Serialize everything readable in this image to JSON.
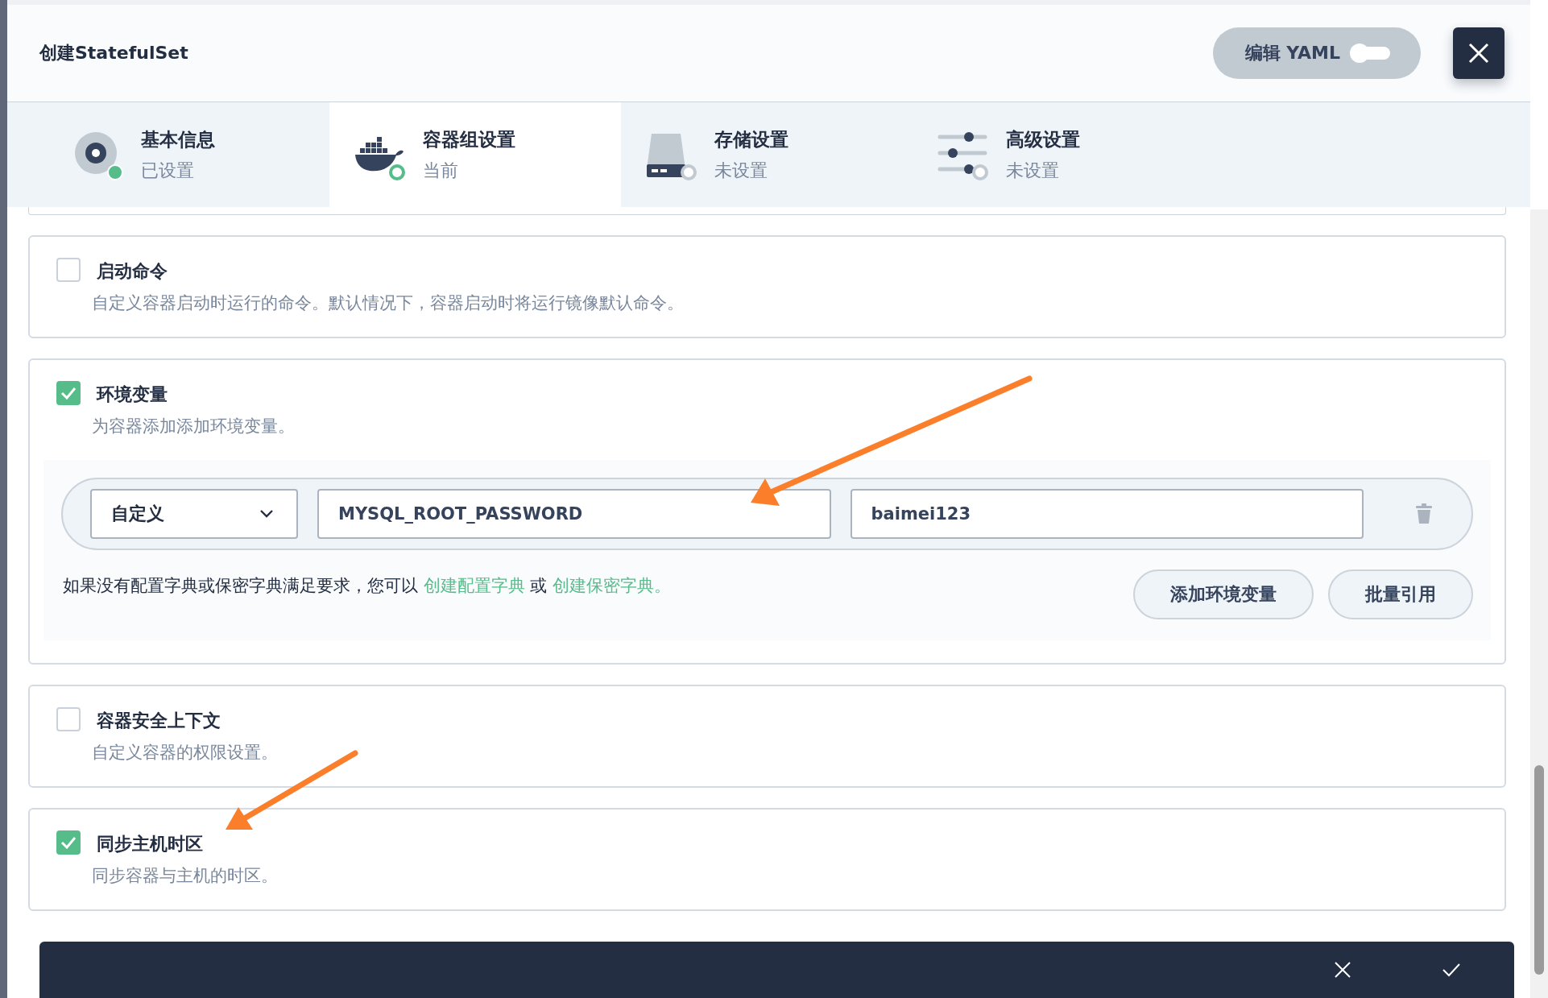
{
  "window": {
    "title": "创建StatefulSet"
  },
  "yaml_toggle": {
    "label": "编辑 YAML",
    "on": false
  },
  "steps": [
    {
      "title": "基本信息",
      "status": "已设置",
      "completed": true,
      "selected": false,
      "kind": "disk"
    },
    {
      "title": "容器组设置",
      "status": "当前",
      "completed": false,
      "selected": true,
      "kind": "docker"
    },
    {
      "title": "存储设置",
      "status": "未设置",
      "completed": false,
      "selected": false,
      "kind": "storage"
    },
    {
      "title": "高级设置",
      "status": "未设置",
      "completed": false,
      "selected": false,
      "kind": "sliders"
    }
  ],
  "sections": [
    {
      "kind": "plain",
      "title": "启动命令",
      "description": "自定义容器启动时运行的命令。默认情况下，容器启动时将运行镜像默认命令。",
      "checked": false
    },
    {
      "kind": "env",
      "title": "环境变量",
      "description": "为容器添加添加环境变量。",
      "checked": true,
      "env_vars": [
        {
          "source": "自定义",
          "name": "MYSQL_ROOT_PASSWORD",
          "value": "baimei123"
        }
      ],
      "hint": {
        "text": "如果没有配置字典或保密字典满足要求，您可以",
        "link_1": "创建配置字典",
        "middle": "或",
        "link_2": "创建保密字典。"
      },
      "buttons": [
        "添加环境变量",
        "批量引用"
      ]
    },
    {
      "kind": "plain",
      "title": "容器安全上下文",
      "description": "自定义容器的权限设置。",
      "checked": false
    },
    {
      "kind": "plain",
      "title": "同步主机时区",
      "description": "同步容器与主机的时区。",
      "checked": true
    }
  ]
}
